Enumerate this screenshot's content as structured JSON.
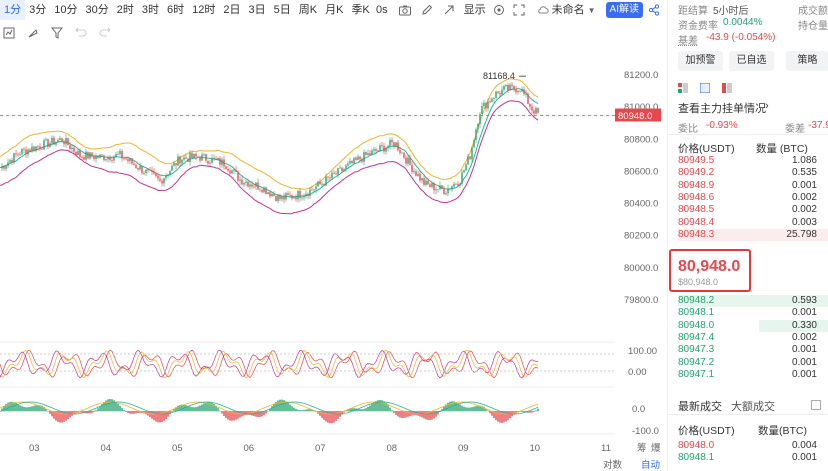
{
  "intervals": [
    "1分",
    "3分",
    "10分",
    "30分",
    "2时",
    "3时",
    "6时",
    "12时",
    "2日",
    "3日",
    "5日",
    "周K",
    "月K",
    "季K"
  ],
  "active_interval": "1分",
  "toolbar": {
    "seconds": "0s",
    "display": "显示",
    "layout_name": "未命名",
    "ai_label": "AI解读"
  },
  "chart": {
    "y_ticks": [
      "81200.0",
      "81000.0",
      "80800.0",
      "80600.0",
      "80400.0",
      "80200.0",
      "80000.0",
      "79800.0"
    ],
    "x_ticks": [
      "03",
      "04",
      "05",
      "06",
      "07",
      "08",
      "09",
      "10",
      "11"
    ],
    "high_label": "81168.4",
    "current_price_tag": "80948.0",
    "osc1_ticks": [
      "100.00",
      "0.00"
    ],
    "osc2_ticks": [
      "0.0",
      "-100.0"
    ],
    "bottom_right": [
      "对数",
      "自动"
    ],
    "side_labels": [
      "筹",
      "爆"
    ]
  },
  "panel": {
    "countdown_label": "距结算",
    "countdown_value": "5小时后",
    "volume_label": "成交额",
    "funding_label": "资金费率",
    "funding_value": "0.0044%",
    "open_interest_label": "持仓量",
    "basis_label": "基差",
    "basis_value": "-43.9 (-0.054%)",
    "buttons": [
      "加预警",
      "已自选",
      "策略"
    ],
    "see_main": "查看主力挂单情况",
    "ratio_label": "委比",
    "ratio_value": "-0.93%",
    "diff_label": "委差",
    "diff_value": "-37.9",
    "ob_header_price": "价格(USDT)",
    "ob_header_qty": "数量 (BTC)",
    "asks": [
      {
        "p": "80949.5",
        "q": "1.086"
      },
      {
        "p": "80949.2",
        "q": "0.535"
      },
      {
        "p": "80948.9",
        "q": "0.001"
      },
      {
        "p": "80948.6",
        "q": "0.002"
      },
      {
        "p": "80948.5",
        "q": "0.002"
      },
      {
        "p": "80948.4",
        "q": "0.003"
      },
      {
        "p": "80948.3",
        "q": "25.798"
      }
    ],
    "last_price": "80,948.0",
    "last_price_usd": "$80,948.0",
    "bids": [
      {
        "p": "80948.2",
        "q": "0.593"
      },
      {
        "p": "80948.1",
        "q": "0.001"
      },
      {
        "p": "80948.0",
        "q": "0.330"
      },
      {
        "p": "80947.4",
        "q": "0.002"
      },
      {
        "p": "80947.3",
        "q": "0.001"
      },
      {
        "p": "80947.2",
        "q": "0.001"
      },
      {
        "p": "80947.1",
        "q": "0.001"
      }
    ],
    "trades_tab": "最新成交",
    "big_trades_tab": "大额成交",
    "trades_header_price": "价格(USDT)",
    "trades_header_qty": "数量(BTC)",
    "trades": [
      {
        "p": "80948.0",
        "q": "0.004"
      },
      {
        "p": "80948.1",
        "q": "0.001"
      }
    ],
    "colors": {
      "up": "#23a26d",
      "down": "#e5484d",
      "accent": "#2b6be9"
    }
  }
}
